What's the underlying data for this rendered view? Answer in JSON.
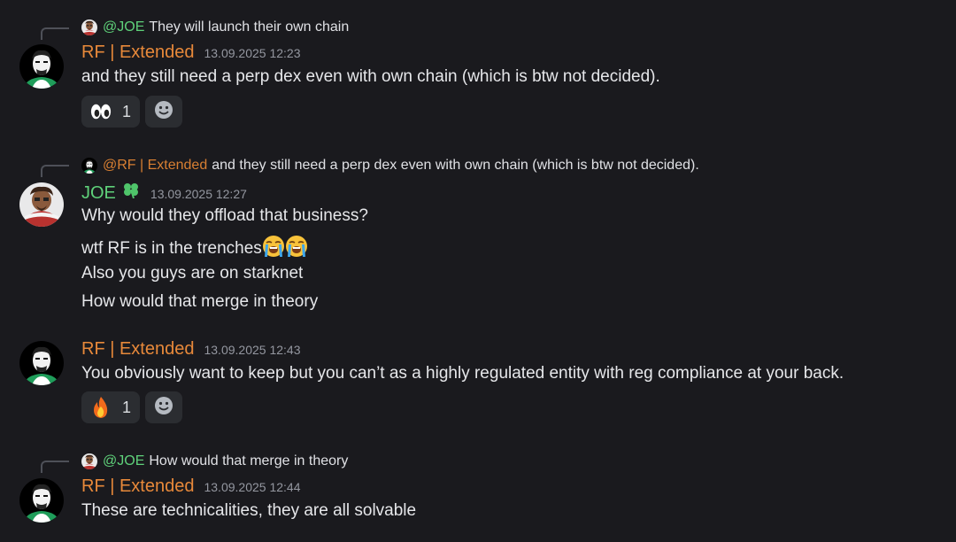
{
  "messages": [
    {
      "reply": {
        "mention": "@JOE",
        "text": "They will launch their own chain"
      },
      "username": "RF | Extended",
      "timestamp": "13.09.2025 12:23",
      "lines": [
        "and they still need a perp dex even with own chain (which is btw not decided)."
      ],
      "reactions": [
        {
          "emoji": "eyes-icon",
          "count": "1"
        }
      ]
    },
    {
      "reply": {
        "mention": "@RF | Extended",
        "text": "and they still need a perp dex even with own chain (which is btw not decided)."
      },
      "username": "JOE",
      "timestamp": "13.09.2025 12:27",
      "lines": [
        "Why would they offload that business?",
        "wtf RF is in the trenches",
        "Also you guys are on starknet",
        "How would that merge in theory"
      ]
    },
    {
      "username": "RF | Extended",
      "timestamp": "13.09.2025 12:43",
      "lines": [
        "You obviously want to keep but you can’t as a highly regulated entity with reg compliance at your back."
      ],
      "reactions": [
        {
          "emoji": "fire-icon",
          "count": "1"
        }
      ]
    },
    {
      "reply": {
        "mention": "@JOE",
        "text": "How would that merge in theory"
      },
      "username": "RF | Extended",
      "timestamp": "13.09.2025 12:44",
      "lines": [
        "These are technicalities, they are all solvable"
      ]
    }
  ],
  "colors": {
    "background": "#1a1a1e",
    "rf_name": "#e8893a",
    "joe_name": "#5fd17a",
    "timestamp": "#9497a0"
  }
}
